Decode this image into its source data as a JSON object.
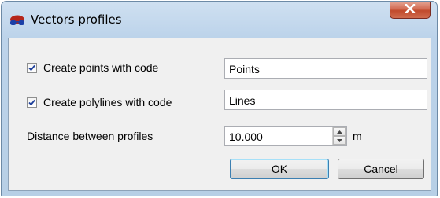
{
  "window": {
    "title": "Vectors profiles",
    "title_icon": "glasses-icon",
    "close_label": "x"
  },
  "points_row": {
    "checked": true,
    "label": "Create points with code",
    "value": "Points"
  },
  "lines_row": {
    "checked": true,
    "label": "Create polylines with code",
    "value": "Lines"
  },
  "distance_row": {
    "label": "Distance between profiles",
    "value": "10.000",
    "unit": "m"
  },
  "buttons": {
    "ok": "OK",
    "cancel": "Cancel"
  },
  "colors": {
    "titlebar": "#bcd3ea",
    "close_button": "#c14a2c",
    "client_bg": "#f0f0f0",
    "check_mark": "#1d3f9a"
  }
}
